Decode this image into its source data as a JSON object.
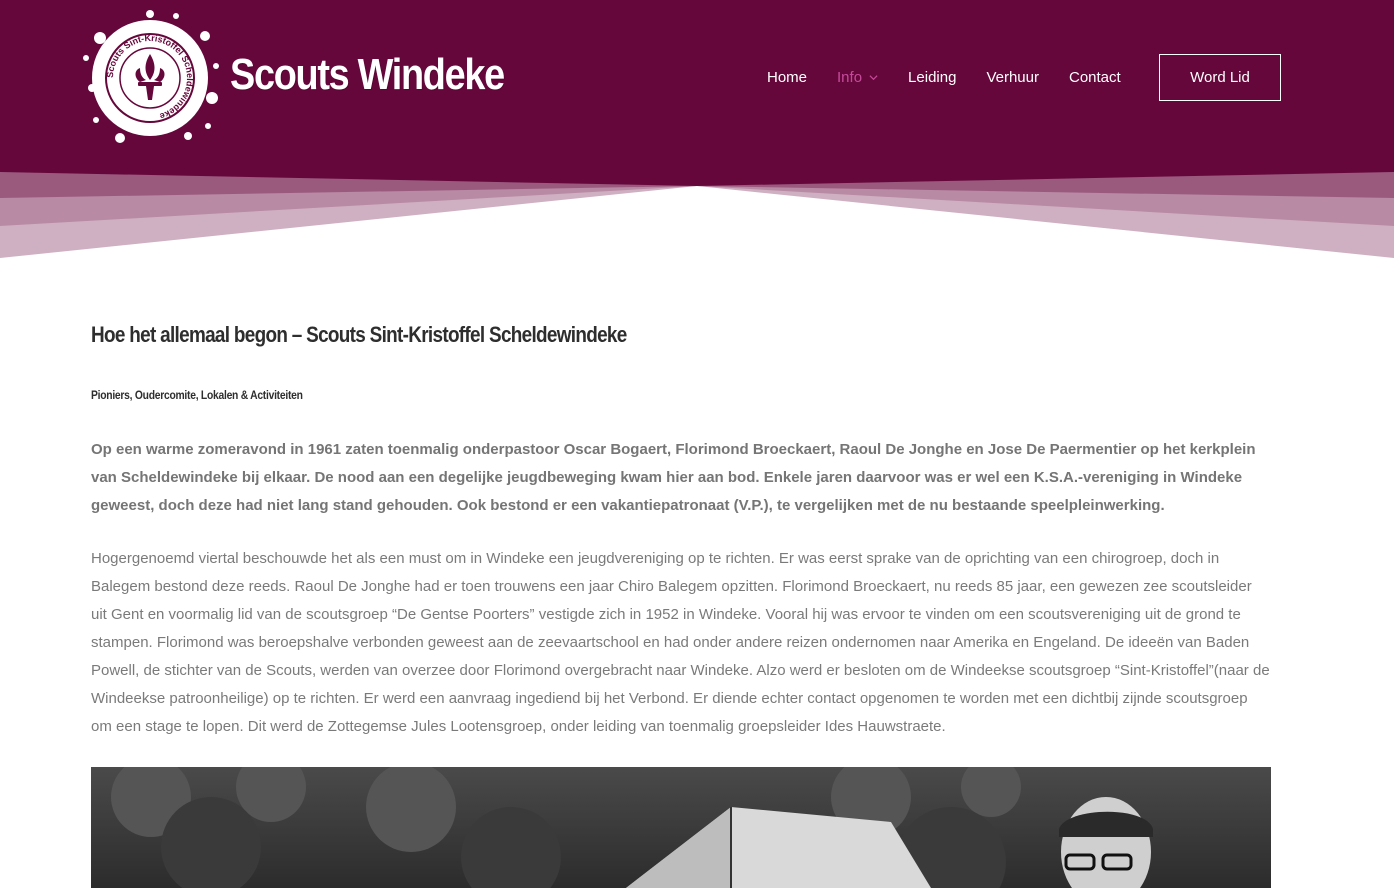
{
  "brand": {
    "site_title": "Scouts Windeke",
    "logo_ring_text": "Scouts Sint-Kristoffel Scheldewindeke",
    "colors": {
      "primary": "#66073b",
      "accent": "#c64a9a",
      "text": "#7a7a7a"
    }
  },
  "nav": {
    "items": [
      {
        "label": "Home",
        "active": false
      },
      {
        "label": "Info",
        "active": true,
        "has_dropdown": true
      },
      {
        "label": "Leiding",
        "active": false
      },
      {
        "label": "Verhuur",
        "active": false
      },
      {
        "label": "Contact",
        "active": false
      }
    ],
    "cta_label": "Word Lid"
  },
  "article": {
    "title": "Hoe het allemaal begon – Scouts Sint-Kristoffel Scheldewindeke",
    "subtitle": "Pioniers, Oudercomite, Lokalen & Activiteiten",
    "intro": "Op een warme zomeravond in 1961 zaten toenmalig onderpastoor Oscar Bogaert, Florimond Broeckaert, Raoul De Jonghe en Jose De Paermentier op het kerkplein van Scheldewindeke bij elkaar. De nood aan een degelijke jeugdbeweging kwam hier aan bod. Enkele jaren daarvoor was er wel een K.S.A.-vereniging in Windeke geweest, doch deze had niet lang stand gehouden. Ook bestond er een vakantiepatronaat (V.P.), te vergelijken met de nu bestaande speelpleinwerking.",
    "body": "Hogergenoemd viertal beschouwde het als een must om in Windeke een jeugdvereniging op te richten. Er was eerst sprake van de oprichting van een chirogroep, doch in Balegem bestond deze reeds. Raoul De Jonghe had er toen trouwens een jaar Chiro Balegem opzitten. Florimond Broeckaert, nu reeds 85 jaar, een gewezen zee scoutsleider uit Gent en voormalig lid van de scoutsgroep “De Gentse Poorters” vestigde zich in 1952 in Windeke. Vooral hij was ervoor te vinden om een scoutsvereniging uit de grond te stampen. Florimond was beroepshalve verbonden geweest aan de zeevaartschool en had onder andere reizen ondernomen naar Amerika en Engeland. De ideeën van Baden Powell, de stichter van de Scouts, werden van overzee door Florimond overgebracht naar Windeke. Alzo werd er besloten om de Windeekse scoutsgroep “Sint-Kristoffel”(naar de Windeekse patroonheilige) op te richten. Er werd een aanvraag ingediend bij het Verbond. Er diende echter contact opgenomen te worden met een dichtbij zijnde scoutsgroep om een stage te lopen. Dit werd de Zottegemse Jules Lootensgroep, onder leiding van toenmalig groepsleider Ides Hauwstraete."
  }
}
